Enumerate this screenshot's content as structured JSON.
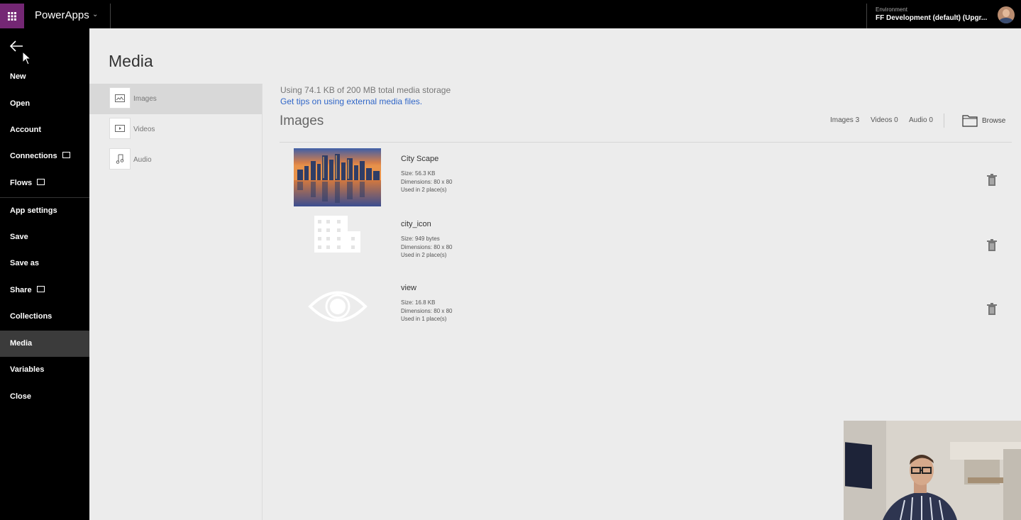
{
  "topbar": {
    "app_name": "PowerApps",
    "environment_label": "Environment",
    "environment_value": "FF Development (default) (Upgr..."
  },
  "nav": {
    "items": [
      {
        "label": "New"
      },
      {
        "label": "Open"
      },
      {
        "label": "Account"
      },
      {
        "label": "Connections"
      },
      {
        "label": "Flows"
      },
      {
        "label": "App settings"
      },
      {
        "label": "Save"
      },
      {
        "label": "Save as"
      },
      {
        "label": "Share"
      },
      {
        "label": "Collections"
      },
      {
        "label": "Media"
      },
      {
        "label": "Variables"
      },
      {
        "label": "Close"
      }
    ],
    "active": "Media"
  },
  "page": {
    "title": "Media",
    "subnav": [
      {
        "label": "Images",
        "icon": "image-icon"
      },
      {
        "label": "Videos",
        "icon": "video-icon"
      },
      {
        "label": "Audio",
        "icon": "music-note-icon"
      }
    ],
    "usage": "Using 74.1 KB of 200 MB total media storage",
    "tips_link": "Get tips on using external media files.",
    "section_title": "Images",
    "counts": {
      "images": "Images 3",
      "videos": "Videos 0",
      "audio": "Audio 0"
    },
    "browse": "Browse"
  },
  "media": [
    {
      "name": "City Scape",
      "size": "Size: 56.3 KB",
      "dimensions": "Dimensions: 80 x 80",
      "used": "Used in 2 place(s)",
      "thumb": "city-photo"
    },
    {
      "name": "city_icon",
      "size": "Size: 949 bytes",
      "dimensions": "Dimensions: 80 x 80",
      "used": "Used in 2 place(s)",
      "thumb": "building-icon"
    },
    {
      "name": "view",
      "size": "Size: 16.8 KB",
      "dimensions": "Dimensions: 80 x 80",
      "used": "Used in 1 place(s)",
      "thumb": "eye-icon"
    }
  ]
}
